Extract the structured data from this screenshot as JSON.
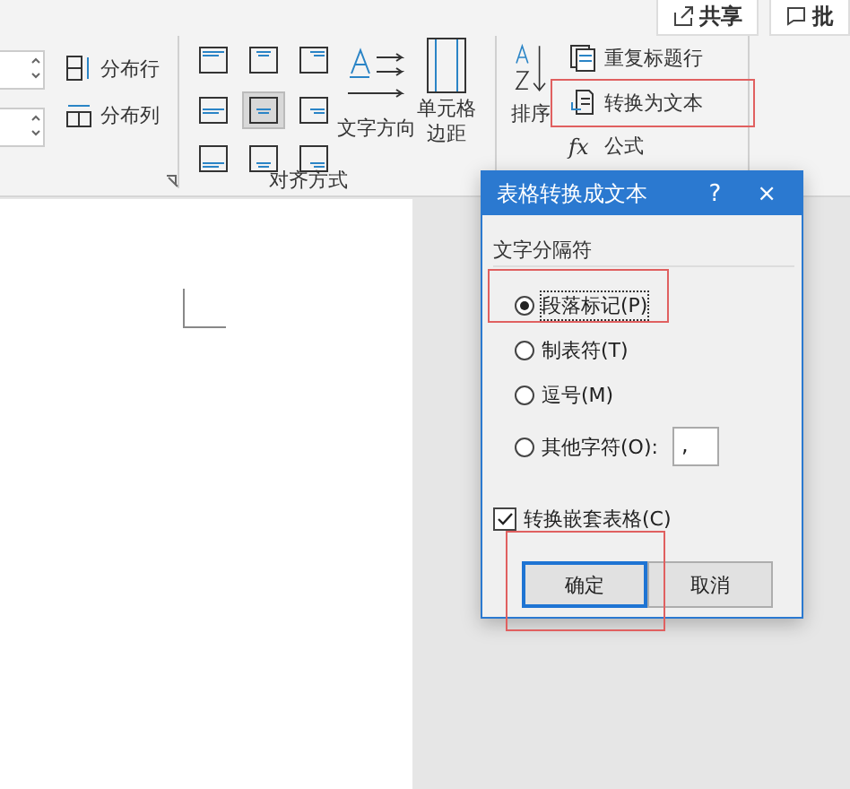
{
  "top_buttons": [
    {
      "label": "共享",
      "kind": "share"
    },
    {
      "label": "批",
      "kind": "comment"
    }
  ],
  "ribbon": {
    "distribute": [
      {
        "label": "分布行",
        "kind": "rows"
      },
      {
        "label": "分布列",
        "kind": "cols"
      }
    ],
    "alignment": [
      {
        "selected": false
      },
      {
        "selected": false
      },
      {
        "selected": false
      },
      {
        "selected": false
      },
      {
        "selected": true
      },
      {
        "selected": false
      },
      {
        "selected": false
      },
      {
        "selected": false
      },
      {
        "selected": false
      }
    ],
    "text_direction": "文字方向",
    "cell_margins": "单元格边距",
    "group_label": "对齐方式",
    "sort": "排序",
    "data_commands": [
      {
        "label": "重复标题行",
        "kind": "repeat"
      },
      {
        "label": "转换为文本",
        "kind": "convert"
      },
      {
        "label": "公式",
        "kind": "formula",
        "icon_text": "fx"
      }
    ]
  },
  "dialog": {
    "title": "表格转换成文本",
    "help": "?",
    "close": "×",
    "group_label": "文字分隔符",
    "options": [
      {
        "label": "段落标记(P)",
        "selected": true
      },
      {
        "label": "制表符(T)",
        "selected": false
      },
      {
        "label": "逗号(M)",
        "selected": false
      },
      {
        "label": "其他字符(O):",
        "selected": false
      }
    ],
    "other_value": ",",
    "nested": {
      "label": "转换嵌套表格(C)",
      "checked": true
    },
    "buttons": [
      {
        "label": "确定",
        "default": true
      },
      {
        "label": "取消",
        "default": false
      }
    ]
  }
}
